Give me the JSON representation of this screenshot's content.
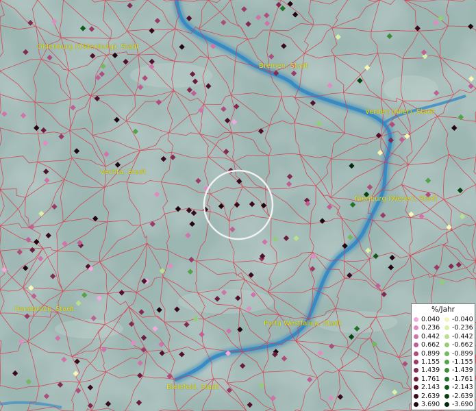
{
  "map": {
    "unit": "%/Jahr",
    "cities": [
      {
        "id": "oldenburg",
        "name": "Oldenburg (Oldenburg), Stadt"
      },
      {
        "id": "bremen",
        "name": "Bremen, Stadt"
      },
      {
        "id": "verden",
        "name": "Verden (Aller), Stadt"
      },
      {
        "id": "vechta",
        "name": "Vechta, Stadt"
      },
      {
        "id": "nienburg",
        "name": "Nienburg (Weser), Stadt"
      },
      {
        "id": "osnabrueck",
        "name": "Osnabrück, Stadt"
      },
      {
        "id": "porta",
        "name": "Porta Westfalica, Stadt"
      },
      {
        "id": "bielefeld",
        "name": "Bielefeld, Stadt"
      }
    ],
    "legend": {
      "title": "%/Jahr",
      "positive": [
        {
          "label": "0.040",
          "color": "#f2a9dc"
        },
        {
          "label": "0.236",
          "color": "#e08cc1"
        },
        {
          "label": "0.442",
          "color": "#cf74aa"
        },
        {
          "label": "0.662",
          "color": "#bf6094"
        },
        {
          "label": "0.899",
          "color": "#ac4d7c"
        },
        {
          "label": "1.155",
          "color": "#983b66"
        },
        {
          "label": "1.439",
          "color": "#822b50"
        },
        {
          "label": "1.761",
          "color": "#6c1d3e"
        },
        {
          "label": "2.143",
          "color": "#52112b"
        },
        {
          "label": "2.639",
          "color": "#3a0a1d"
        },
        {
          "label": "3.690",
          "color": "#210511"
        }
      ],
      "negative": [
        {
          "label": "-0.040",
          "color": "#f4f7b8"
        },
        {
          "label": "-0.236",
          "color": "#d9f0a8"
        },
        {
          "label": "-0.442",
          "color": "#b7e08f"
        },
        {
          "label": "-0.662",
          "color": "#95cc76"
        },
        {
          "label": "-0.899",
          "color": "#74b85f"
        },
        {
          "label": "-1.155",
          "color": "#55a24a"
        },
        {
          "label": "-1.439",
          "color": "#3b8b38"
        },
        {
          "label": "-1.761",
          "color": "#247229"
        },
        {
          "label": "-2.143",
          "color": "#125a1c"
        },
        {
          "label": "-2.639",
          "color": "#084212"
        },
        {
          "label": "-3.690",
          "color": "#02280a"
        }
      ]
    }
  }
}
